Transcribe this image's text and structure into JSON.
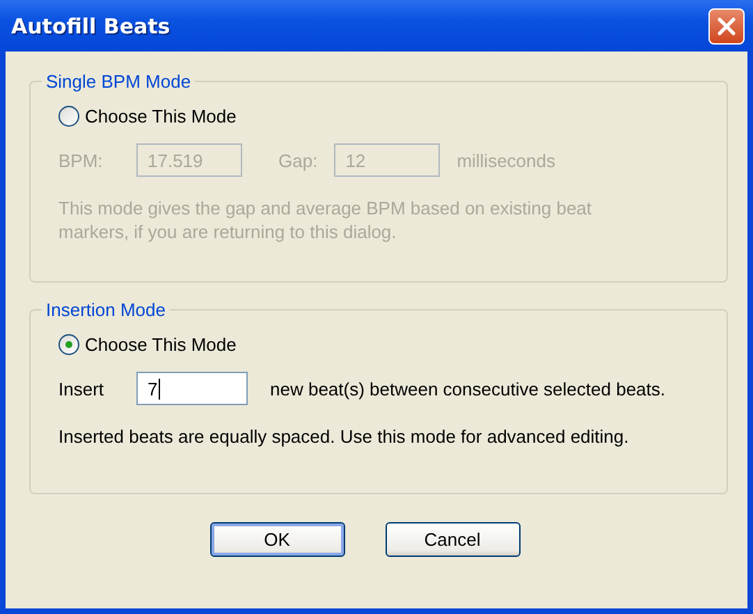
{
  "window": {
    "title": "Autofill Beats"
  },
  "single_bpm_mode": {
    "legend": "Single BPM Mode",
    "radio": {
      "label": "Choose This Mode",
      "selected": false
    },
    "disabled": true,
    "bpm_label": "BPM:",
    "bpm_value": "17.519",
    "gap_label": "Gap:",
    "gap_value": "12",
    "unit": "milliseconds",
    "description": "This mode gives the gap and average BPM based on existing beat markers, if you are returning to this dialog."
  },
  "insertion_mode": {
    "legend": "Insertion Mode",
    "radio": {
      "label": "Choose This Mode",
      "selected": true
    },
    "disabled": false,
    "insert_label": "Insert",
    "insert_value": "7",
    "after_label": "new beat(s) between consecutive selected beats.",
    "description": "Inserted beats are equally spaced. Use this mode for advanced editing."
  },
  "buttons": [
    {
      "label": "OK",
      "default": true
    },
    {
      "label": "Cancel",
      "default": false
    }
  ]
}
